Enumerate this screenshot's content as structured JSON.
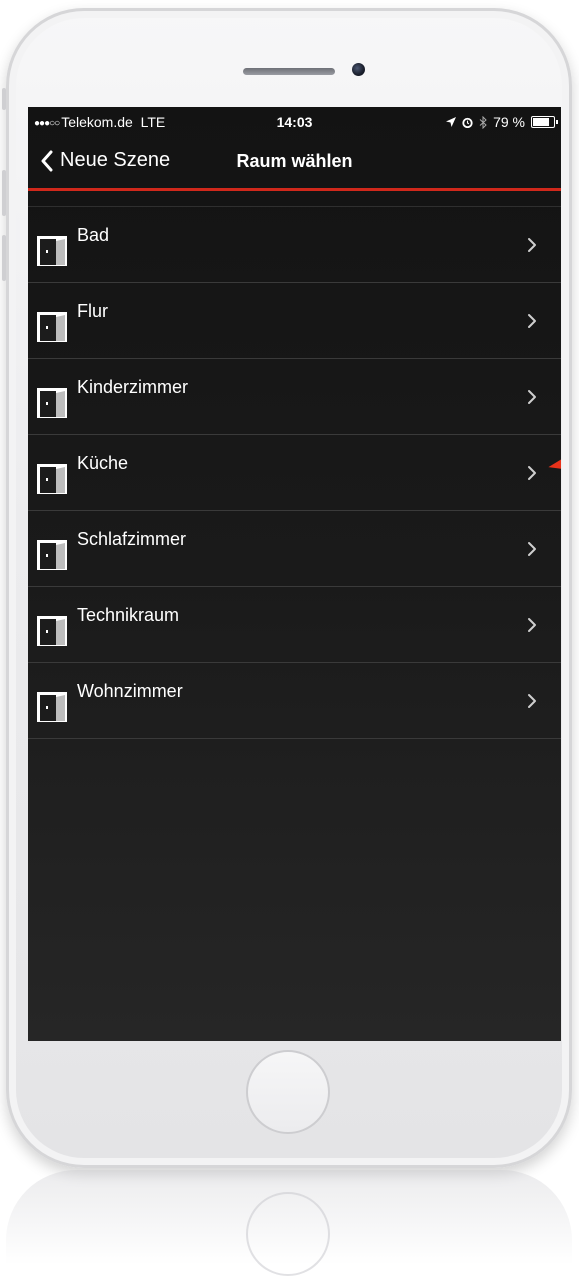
{
  "status_bar": {
    "signal": "●●●○○",
    "carrier": "Telekom.de",
    "network": "LTE",
    "time": "14:03",
    "battery_percent": "79 %",
    "battery_level": 0.79,
    "icons": [
      "location-arrow-icon",
      "alarm-icon",
      "bluetooth-icon",
      "battery-icon"
    ]
  },
  "nav": {
    "back_label": "Neue Szene",
    "title": "Raum wählen"
  },
  "rooms": [
    {
      "label": "Bad"
    },
    {
      "label": "Flur"
    },
    {
      "label": "Kinderzimmer"
    },
    {
      "label": "Küche"
    },
    {
      "label": "Schlafzimmer"
    },
    {
      "label": "Technikraum"
    },
    {
      "label": "Wohnzimmer"
    }
  ],
  "colors": {
    "accent": "#d0281b",
    "background": "#1a1a1a",
    "text": "#ffffff"
  }
}
